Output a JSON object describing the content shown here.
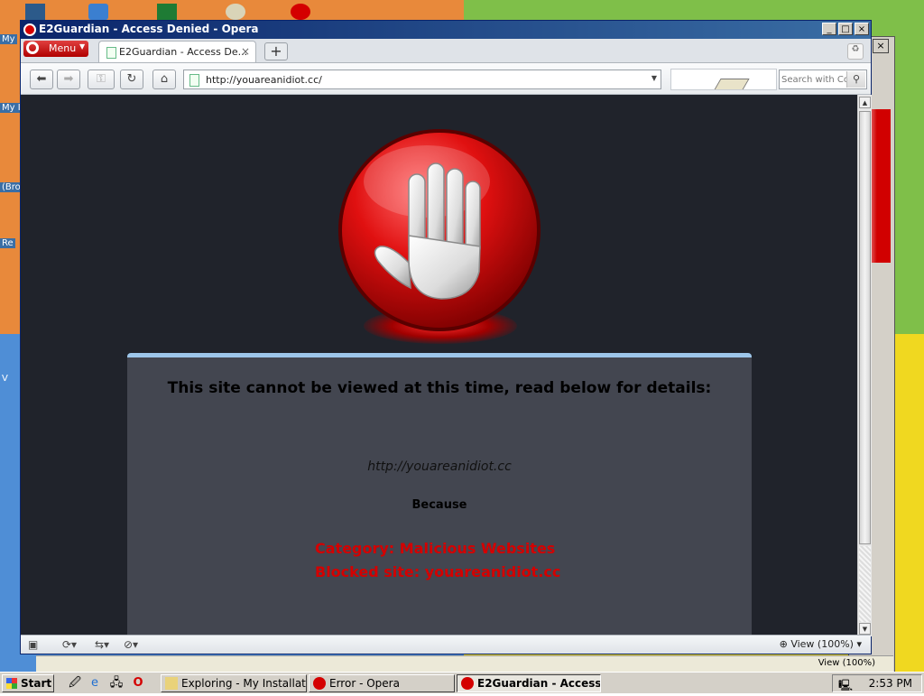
{
  "window": {
    "title": "E2Guardian - Access Denied - Opera"
  },
  "browser": {
    "menu_label": "Menu",
    "tab_label": "E2Guardian - Access De...",
    "address": "http://youareanidiot.cc/",
    "search_placeholder": "Search with Co",
    "zoom": "View (100%)"
  },
  "page": {
    "headline": "This site cannot be viewed at this time, read below for details:",
    "blocked_url": "http://youareanidiot.cc",
    "because": "Because",
    "category": "Category: Malicious Websites",
    "blocked_site": "Blocked site: youareanidiot.cc"
  },
  "background_window": {
    "zoom": "View (100%)"
  },
  "desktop": {
    "labels": [
      "My",
      "My I",
      "(Bro",
      "Re",
      "V"
    ]
  },
  "taskbar": {
    "start_label": "Start",
    "tasks": [
      {
        "label": "Exploring - My Installati...",
        "active": false
      },
      {
        "label": "Error - Opera",
        "active": false
      },
      {
        "label": "E2Guardian - Access...",
        "active": true
      }
    ],
    "clock": "2:53 PM"
  },
  "colors": {
    "page_bg": "#20232b",
    "panel_bg": "#434650",
    "panel_accent": "#9dc6ea",
    "alert_red": "#d40000",
    "title_bar": "#0a246a"
  }
}
